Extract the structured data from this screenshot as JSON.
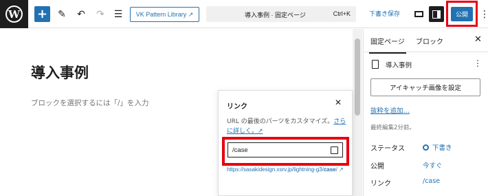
{
  "toolbar": {
    "logo_text": "W",
    "pattern_library": "VK Pattern Library ↗",
    "command_title": "導入事例 · 固定ページ",
    "command_shortcut": "Ctrl+K",
    "save_draft": "下書き保存",
    "publish": "公開"
  },
  "editor": {
    "post_title": "導入事例",
    "block_placeholder": "ブロックを選択するには「/」を入力"
  },
  "link_popover": {
    "title": "リンク",
    "description": "URL の最後のパーツをカスタマイズ。",
    "learn_more": "さらに詳しく。↗",
    "slug_value": "/case",
    "url_prefix": "https://sasakidesign.xsrv.jp/lightning-g3/",
    "url_slug": "case",
    "url_suffix": "/ ↗"
  },
  "sidebar": {
    "tabs": [
      "固定ページ",
      "ブロック"
    ],
    "doc_title": "導入事例",
    "featured_image_button": "アイキャッチ画像を設定",
    "add_excerpt": "抜粋を追加…",
    "last_edited": "最終編集2分前。",
    "rows": [
      {
        "label": "ステータス",
        "value": "下書き"
      },
      {
        "label": "公開",
        "value": "今すぐ"
      },
      {
        "label": "リンク",
        "value": "/case"
      }
    ]
  },
  "colors": {
    "accent": "#2271b1",
    "highlight": "#e60012",
    "dark": "#1e1e1e"
  }
}
